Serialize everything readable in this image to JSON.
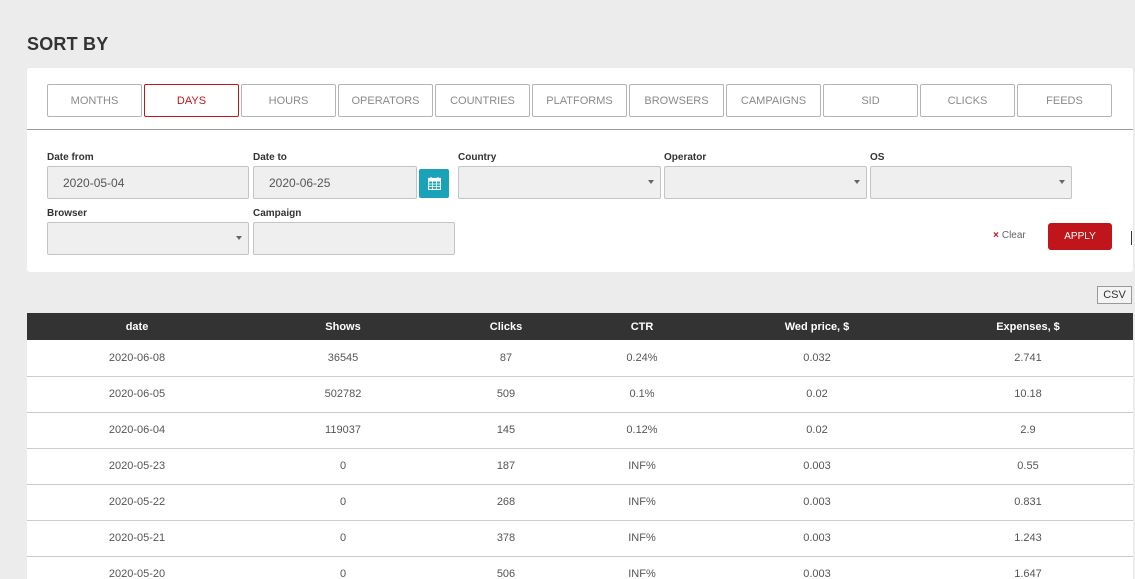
{
  "page_title": "SORT BY",
  "tabs": [
    {
      "label": "MONTHS",
      "active": false
    },
    {
      "label": "DAYS",
      "active": true
    },
    {
      "label": "HOURS",
      "active": false
    },
    {
      "label": "OPERATORS",
      "active": false
    },
    {
      "label": "COUNTRIES",
      "active": false
    },
    {
      "label": "PLATFORMS",
      "active": false
    },
    {
      "label": "BROWSERS",
      "active": false
    },
    {
      "label": "CAMPAIGNS",
      "active": false
    },
    {
      "label": "SID",
      "active": false
    },
    {
      "label": "CLICKS",
      "active": false
    },
    {
      "label": "FEEDS",
      "active": false
    }
  ],
  "filters": {
    "date_from": {
      "label": "Date from",
      "value": "2020-05-04"
    },
    "date_to": {
      "label": "Date to",
      "value": "2020-06-25"
    },
    "country": {
      "label": "Country",
      "value": ""
    },
    "operator": {
      "label": "Operator",
      "value": ""
    },
    "os": {
      "label": "OS",
      "value": ""
    },
    "browser": {
      "label": "Browser",
      "value": ""
    },
    "campaign": {
      "label": "Campaign",
      "value": ""
    },
    "calendar_icon": "calendar-icon",
    "clear_label": "Clear",
    "clear_icon": "×",
    "apply_label": "APPLY"
  },
  "csv_label": "CSV",
  "table": {
    "columns": [
      "date",
      "Shows",
      "Clicks",
      "CTR",
      "Wed price, $",
      "Expenses, $"
    ],
    "rows": [
      [
        "2020-06-08",
        "36545",
        "87",
        "0.24%",
        "0.032",
        "2.741"
      ],
      [
        "2020-06-05",
        "502782",
        "509",
        "0.1%",
        "0.02",
        "10.18"
      ],
      [
        "2020-06-04",
        "119037",
        "145",
        "0.12%",
        "0.02",
        "2.9"
      ],
      [
        "2020-05-23",
        "0",
        "187",
        "INF%",
        "0.003",
        "0.55"
      ],
      [
        "2020-05-22",
        "0",
        "268",
        "INF%",
        "0.003",
        "0.831"
      ],
      [
        "2020-05-21",
        "0",
        "378",
        "INF%",
        "0.003",
        "1.243"
      ],
      [
        "2020-05-20",
        "0",
        "506",
        "INF%",
        "0.003",
        "1.647"
      ]
    ]
  },
  "colors": {
    "accent": "#c0161b",
    "calendar_button": "#1aa3b8",
    "table_header": "#333333"
  }
}
